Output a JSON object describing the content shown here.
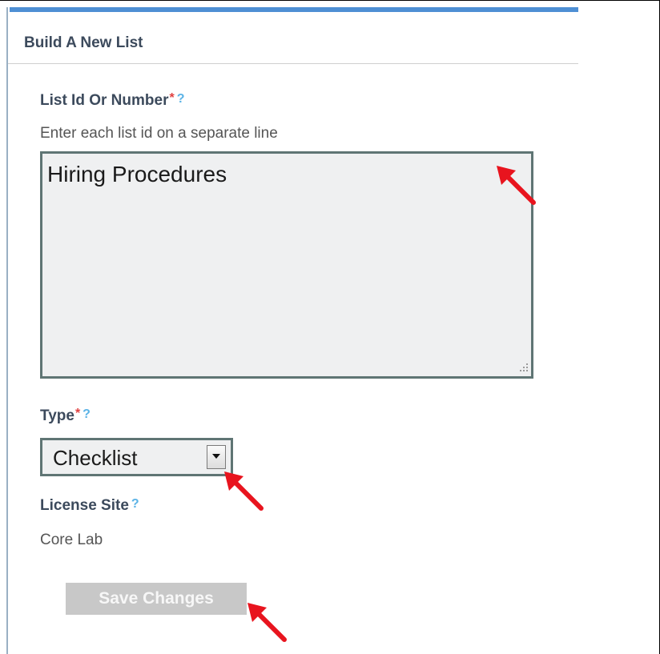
{
  "panel": {
    "title": "Build A New List"
  },
  "list_id": {
    "label": "List Id Or Number",
    "required_mark": "*",
    "help_icon": "?",
    "hint": "Enter each list id on a separate line",
    "value": "Hiring Procedures"
  },
  "type": {
    "label": "Type",
    "required_mark": "*",
    "help_icon": "?",
    "selected": "Checklist"
  },
  "license_site": {
    "label": "License Site",
    "help_icon": "?",
    "value": "Core Lab"
  },
  "actions": {
    "save_label": "Save Changes"
  },
  "colors": {
    "annotation_arrow": "#e8141e",
    "accent_bar": "#4e8fd4",
    "required": "#e04040",
    "help": "#5bb3e6"
  }
}
